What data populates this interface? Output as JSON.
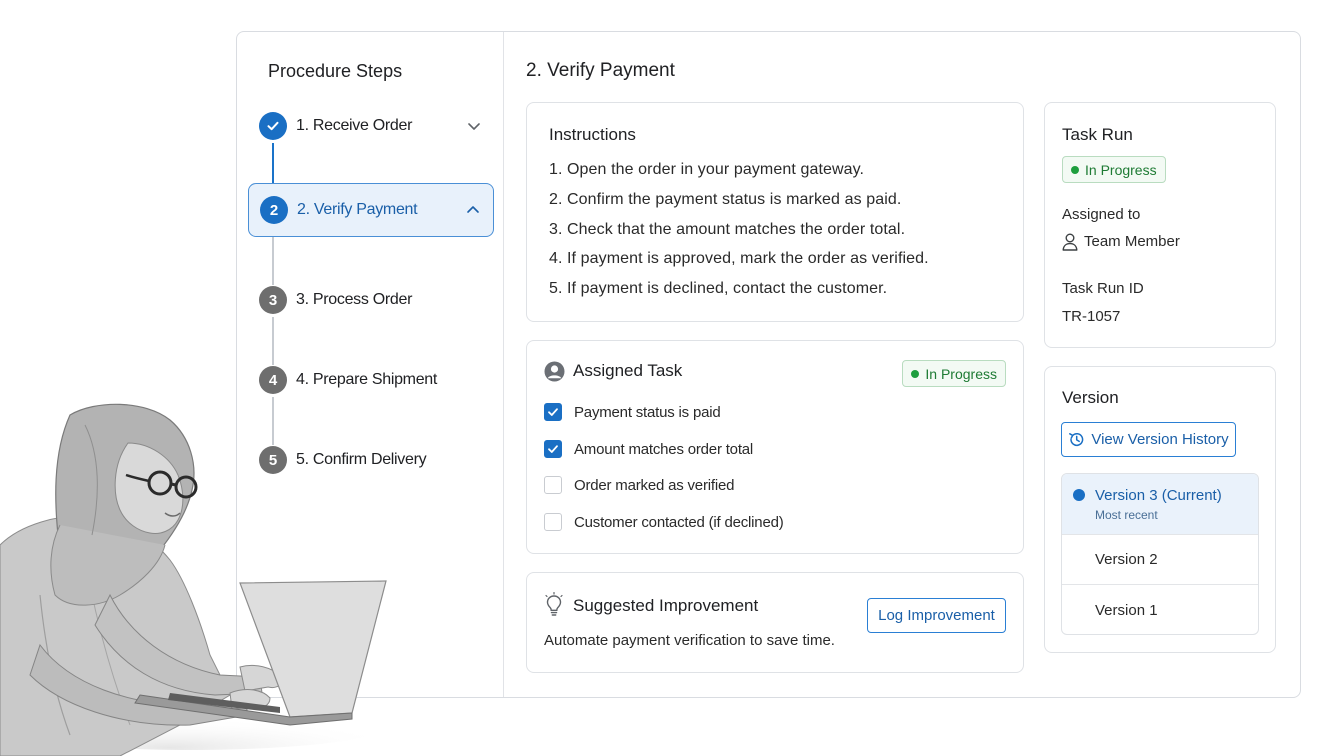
{
  "sidebar": {
    "title": "Procedure Steps",
    "steps": [
      {
        "number": "1",
        "label": "1. Receive Order",
        "state": "done"
      },
      {
        "number": "2",
        "label": "2. Verify Payment",
        "state": "active"
      },
      {
        "number": "3",
        "label": "3. Process Order",
        "state": "pending"
      },
      {
        "number": "4",
        "label": "4. Prepare Shipment",
        "state": "pending"
      },
      {
        "number": "5",
        "label": "5. Confirm Delivery",
        "state": "pending"
      }
    ]
  },
  "main": {
    "title": "2. Verify Payment",
    "instructions": {
      "title": "Instructions",
      "items": [
        {
          "num": "1.",
          "text": "Open the order in your payment gateway."
        },
        {
          "num": "2.",
          "text": "Confirm the payment status is marked as paid."
        },
        {
          "num": "3.",
          "text": "Check that the amount matches the order total."
        },
        {
          "num": "4.",
          "text": "If payment is approved, mark the order as verified."
        },
        {
          "num": "5.",
          "text": "If payment is declined, contact the customer."
        }
      ]
    },
    "assigned_task": {
      "title": "Assigned Task",
      "status": "In Progress",
      "checklist": [
        {
          "label": "Payment status is paid",
          "checked": true
        },
        {
          "label": "Amount matches order total",
          "checked": true
        },
        {
          "label": "Order marked as verified",
          "checked": false
        },
        {
          "label": "Customer contacted (if declined)",
          "checked": false
        }
      ]
    },
    "suggested": {
      "title": "Suggested Improvement",
      "text": "Automate payment verification to save time.",
      "button": "Log Improvement"
    }
  },
  "task_run": {
    "title": "Task Run",
    "status": "In Progress",
    "assigned_label": "Assigned to",
    "assignee": "Team Member",
    "id_label": "Task Run ID",
    "id_value": "TR-1057"
  },
  "version": {
    "title": "Version",
    "history_button": "View Version History",
    "items": [
      {
        "label": "Version 3 (Current)",
        "sub": "Most recent",
        "current": true
      },
      {
        "label": "Version 2",
        "sub": "",
        "current": false
      },
      {
        "label": "Version 1",
        "sub": "",
        "current": false
      }
    ]
  },
  "colors": {
    "accent": "#1a6fc4",
    "status_green": "#1e7b34",
    "active_bg": "#e8f1fb"
  }
}
